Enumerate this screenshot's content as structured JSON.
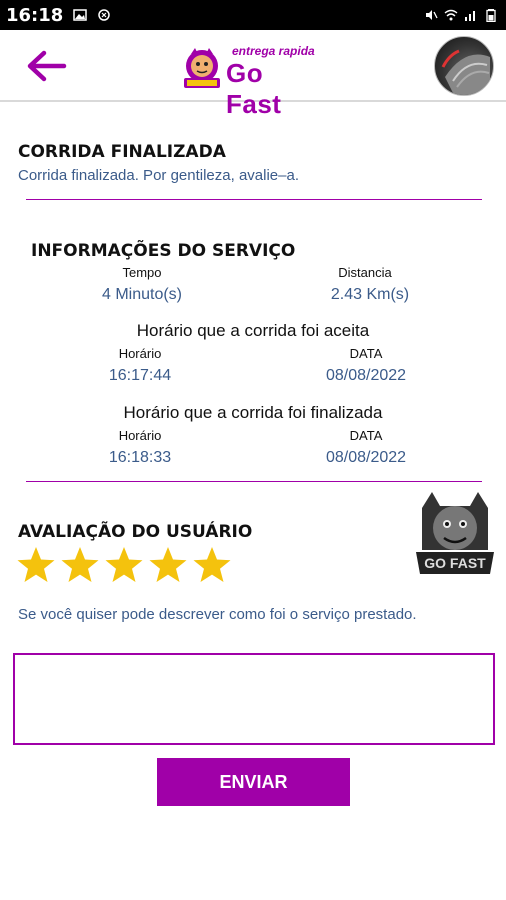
{
  "status_bar": {
    "time": "16:18"
  },
  "header": {
    "tagline": "entrega rapida",
    "brand": "Go Fast",
    "back_icon": "arrow-left-icon",
    "accent_color": "#a000a8"
  },
  "finish": {
    "title": "CORRIDA FINALIZADA",
    "message": "Corrida finalizada. Por gentileza, avalie–a."
  },
  "service_info": {
    "title": "INFORMAÇÕES DO SERVIÇO",
    "time_label": "Tempo",
    "time_value": "4 Minuto(s)",
    "distance_label": "Distancia",
    "distance_value": "2.43 Km(s)",
    "accepted": {
      "heading": "Horário que a corrida foi aceita",
      "hour_label": "Horário",
      "hour_value": "16:17:44",
      "date_label": "DATA",
      "date_value": "08/08/2022"
    },
    "finished": {
      "heading": "Horário que a corrida foi finalizada",
      "hour_label": "Horário",
      "hour_value": "16:18:33",
      "date_label": "DATA",
      "date_value": "08/08/2022"
    }
  },
  "rating": {
    "title": "AVALIAÇÃO DO USUÁRIO",
    "stars": 5,
    "max_stars": 5,
    "star_color": "#f4c20d",
    "hint": "Se você quiser pode descrever como foi o serviço prestado."
  },
  "comment": {
    "value": "",
    "placeholder": ""
  },
  "actions": {
    "send_label": "ENVIAR"
  }
}
